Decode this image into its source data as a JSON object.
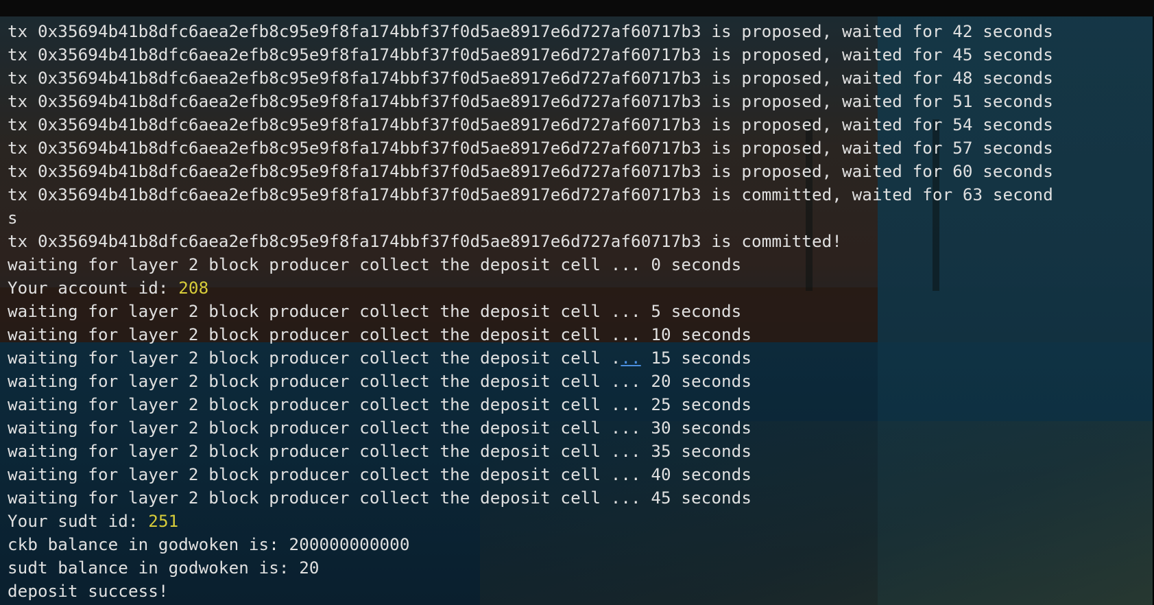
{
  "terminal": {
    "lines_before_account": [
      "tx 0x35694b41b8dfc6aea2efb8c95e9f8fa174bbf37f0d5ae8917e6d727af60717b3 is proposed, waited for 42 seconds",
      "tx 0x35694b41b8dfc6aea2efb8c95e9f8fa174bbf37f0d5ae8917e6d727af60717b3 is proposed, waited for 45 seconds",
      "tx 0x35694b41b8dfc6aea2efb8c95e9f8fa174bbf37f0d5ae8917e6d727af60717b3 is proposed, waited for 48 seconds",
      "tx 0x35694b41b8dfc6aea2efb8c95e9f8fa174bbf37f0d5ae8917e6d727af60717b3 is proposed, waited for 51 seconds",
      "tx 0x35694b41b8dfc6aea2efb8c95e9f8fa174bbf37f0d5ae8917e6d727af60717b3 is proposed, waited for 54 seconds",
      "tx 0x35694b41b8dfc6aea2efb8c95e9f8fa174bbf37f0d5ae8917e6d727af60717b3 is proposed, waited for 57 seconds",
      "tx 0x35694b41b8dfc6aea2efb8c95e9f8fa174bbf37f0d5ae8917e6d727af60717b3 is proposed, waited for 60 seconds",
      "tx 0x35694b41b8dfc6aea2efb8c95e9f8fa174bbf37f0d5ae8917e6d727af60717b3 is committed, waited for 63 second",
      "s",
      "tx 0x35694b41b8dfc6aea2efb8c95e9f8fa174bbf37f0d5ae8917e6d727af60717b3 is committed!",
      "waiting for layer 2 block producer collect the deposit cell ... 0 seconds"
    ],
    "account_label": "Your account id: ",
    "account_id": "208",
    "wait_lines_a": [
      "waiting for layer 2 block producer collect the deposit cell ... 5 seconds",
      "waiting for layer 2 block producer collect the deposit cell ... 10 seconds"
    ],
    "wait_15": {
      "prefix": "waiting for layer 2 block producer collect the deposit cell .",
      "link": "..",
      "suffix": " 15 seconds"
    },
    "wait_lines_b": [
      "waiting for layer 2 block producer collect the deposit cell ... 20 seconds",
      "waiting for layer 2 block producer collect the deposit cell ... 25 seconds",
      "waiting for layer 2 block producer collect the deposit cell ... 30 seconds",
      "waiting for layer 2 block producer collect the deposit cell ... 35 seconds",
      "waiting for layer 2 block producer collect the deposit cell ... 40 seconds",
      "waiting for layer 2 block producer collect the deposit cell ... 45 seconds"
    ],
    "sudt_label": "Your sudt id: ",
    "sudt_id": "251",
    "ckb_balance": "ckb balance in godwoken is: 200000000000",
    "sudt_balance": "sudt balance in godwoken is: 20",
    "result": "deposit success!"
  },
  "colors": {
    "text": "#e0e0e0",
    "highlight_number": "#d8cd3a",
    "link": "#4a8fe0"
  }
}
